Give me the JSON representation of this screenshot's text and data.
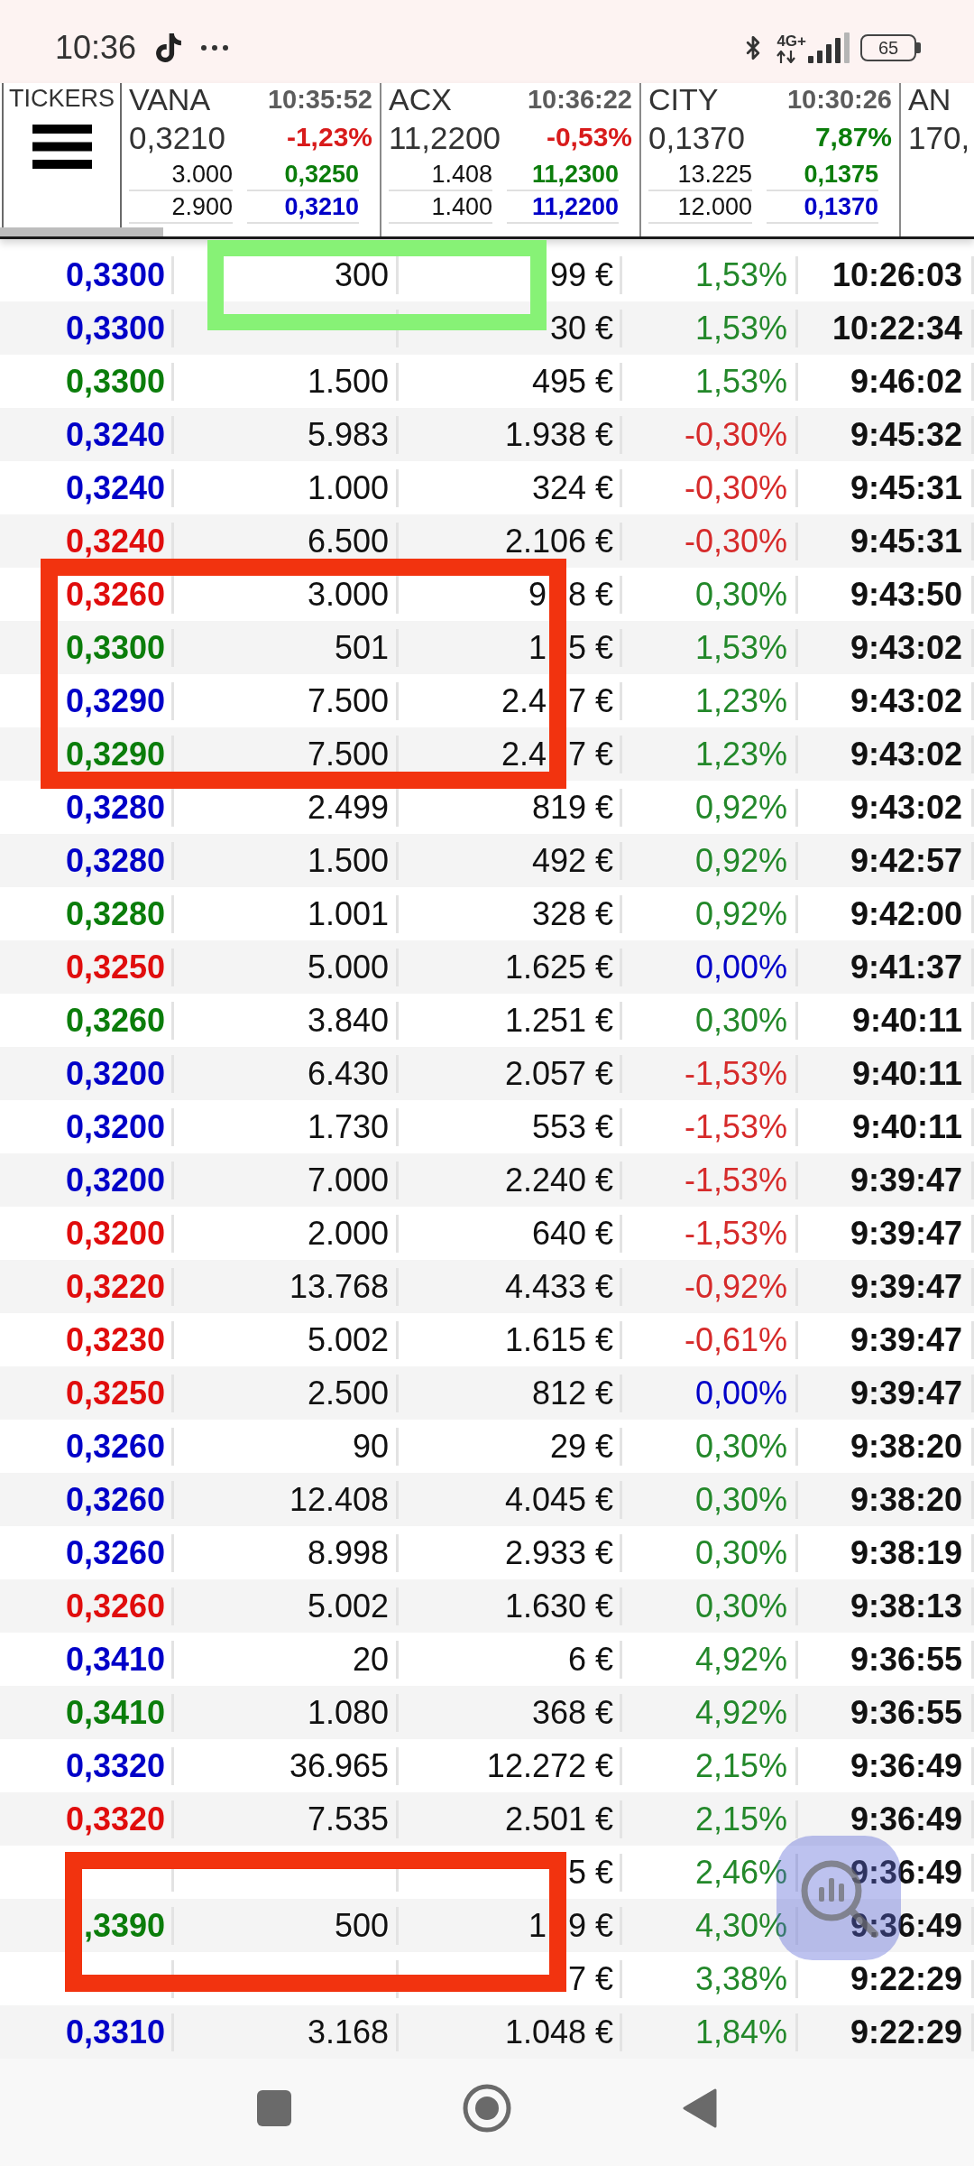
{
  "status_bar": {
    "time": "10:36",
    "network": "4G+",
    "battery": "65"
  },
  "tickers_panel": {
    "label": "TICKERS"
  },
  "tickers": [
    {
      "symbol": "VANA",
      "time": "10:35:52",
      "price": "0,3210",
      "change": {
        "text": "-1,23%",
        "color": "#d81b1b"
      },
      "depth": [
        {
          "quantity": "3.000",
          "price": {
            "text": "0,3250",
            "color": "#0b7d0b"
          }
        },
        {
          "quantity": "2.900",
          "price": {
            "text": "0,3210",
            "color": "#0000c8"
          }
        }
      ]
    },
    {
      "symbol": "ACX",
      "time": "10:36:22",
      "price": "11,2200",
      "change": {
        "text": "-0,53%",
        "color": "#d81b1b"
      },
      "depth": [
        {
          "quantity": "1.408",
          "price": {
            "text": "11,2300",
            "color": "#0b7d0b"
          }
        },
        {
          "quantity": "1.400",
          "price": {
            "text": "11,2200",
            "color": "#0000c8"
          }
        }
      ]
    },
    {
      "symbol": "CITY",
      "time": "10:30:26",
      "price": "0,1370",
      "change": {
        "text": "7,87%",
        "color": "#0b7d0b"
      },
      "depth": [
        {
          "quantity": "13.225",
          "price": {
            "text": "0,1375",
            "color": "#0b7d0b"
          }
        },
        {
          "quantity": "12.000",
          "price": {
            "text": "0,1370",
            "color": "#0000c8"
          }
        }
      ]
    },
    {
      "symbol": "AN",
      "price": "170,"
    }
  ],
  "trades": [
    {
      "price": {
        "text": "0,3300",
        "color": "#0000c8"
      },
      "quantity": "300",
      "amount": "99 €",
      "change": {
        "text": "1,53%",
        "color": "#23882a"
      },
      "time": "10:26:03"
    },
    {
      "price": {
        "text": "0,3300",
        "color": "#0000c8"
      },
      "amount": "30 €",
      "change": {
        "text": "1,53%",
        "color": "#23882a"
      },
      "time": "10:22:34"
    },
    {
      "price": {
        "text": "0,3300",
        "color": "#0b7d0b"
      },
      "quantity": "1.500",
      "amount": "495 €",
      "change": {
        "text": "1,53%",
        "color": "#23882a"
      },
      "time": "9:46:02"
    },
    {
      "price": {
        "text": "0,3240",
        "color": "#0000c8"
      },
      "quantity": "5.983",
      "amount": "1.938 €",
      "change": {
        "text": "-0,30%",
        "color": "#d62b2b"
      },
      "time": "9:45:32"
    },
    {
      "price": {
        "text": "0,3240",
        "color": "#0000c8"
      },
      "quantity": "1.000",
      "amount": "324 €",
      "change": {
        "text": "-0,30%",
        "color": "#d62b2b"
      },
      "time": "9:45:31"
    },
    {
      "price": {
        "text": "0,3240",
        "color": "#e00d0d"
      },
      "quantity": "6.500",
      "amount": "2.106 €",
      "change": {
        "text": "-0,30%",
        "color": "#d62b2b"
      },
      "time": "9:45:31"
    },
    {
      "price": {
        "text": "0,3260",
        "color": "#e00d0d"
      },
      "quantity": "3.000",
      "amount_parts": [
        "9",
        "8 €"
      ],
      "change": {
        "text": "0,30%",
        "color": "#23882a"
      },
      "time": "9:43:50"
    },
    {
      "price": {
        "text": "0,3300",
        "color": "#0b7d0b"
      },
      "quantity": "501",
      "amount_parts": [
        "1",
        "5 €"
      ],
      "change": {
        "text": "1,53%",
        "color": "#23882a"
      },
      "time": "9:43:02"
    },
    {
      "price": {
        "text": "0,3290",
        "color": "#0000c8"
      },
      "quantity": "7.500",
      "amount_parts": [
        "2.4",
        "7 €"
      ],
      "change": {
        "text": "1,23%",
        "color": "#23882a"
      },
      "time": "9:43:02"
    },
    {
      "price": {
        "text": "0,3290",
        "color": "#0b7d0b"
      },
      "quantity": "7.500",
      "amount_parts": [
        "2.4",
        "7 €"
      ],
      "change": {
        "text": "1,23%",
        "color": "#23882a"
      },
      "time": "9:43:02"
    },
    {
      "price": {
        "text": "0,3280",
        "color": "#0000c8"
      },
      "quantity": "2.499",
      "amount": "819 €",
      "change": {
        "text": "0,92%",
        "color": "#23882a"
      },
      "time": "9:43:02"
    },
    {
      "price": {
        "text": "0,3280",
        "color": "#0000c8"
      },
      "quantity": "1.500",
      "amount": "492 €",
      "change": {
        "text": "0,92%",
        "color": "#23882a"
      },
      "time": "9:42:57"
    },
    {
      "price": {
        "text": "0,3280",
        "color": "#0b7d0b"
      },
      "quantity": "1.001",
      "amount": "328 €",
      "change": {
        "text": "0,92%",
        "color": "#23882a"
      },
      "time": "9:42:00"
    },
    {
      "price": {
        "text": "0,3250",
        "color": "#e00d0d"
      },
      "quantity": "5.000",
      "amount": "1.625 €",
      "change": {
        "text": "0,00%",
        "color": "#0000c8"
      },
      "time": "9:41:37"
    },
    {
      "price": {
        "text": "0,3260",
        "color": "#0b7d0b"
      },
      "quantity": "3.840",
      "amount": "1.251 €",
      "change": {
        "text": "0,30%",
        "color": "#23882a"
      },
      "time": "9:40:11"
    },
    {
      "price": {
        "text": "0,3200",
        "color": "#0000c8"
      },
      "quantity": "6.430",
      "amount": "2.057 €",
      "change": {
        "text": "-1,53%",
        "color": "#d62b2b"
      },
      "time": "9:40:11"
    },
    {
      "price": {
        "text": "0,3200",
        "color": "#0000c8"
      },
      "quantity": "1.730",
      "amount": "553 €",
      "change": {
        "text": "-1,53%",
        "color": "#d62b2b"
      },
      "time": "9:40:11"
    },
    {
      "price": {
        "text": "0,3200",
        "color": "#0000c8"
      },
      "quantity": "7.000",
      "amount": "2.240 €",
      "change": {
        "text": "-1,53%",
        "color": "#d62b2b"
      },
      "time": "9:39:47"
    },
    {
      "price": {
        "text": "0,3200",
        "color": "#e00d0d"
      },
      "quantity": "2.000",
      "amount": "640 €",
      "change": {
        "text": "-1,53%",
        "color": "#d62b2b"
      },
      "time": "9:39:47"
    },
    {
      "price": {
        "text": "0,3220",
        "color": "#e00d0d"
      },
      "quantity": "13.768",
      "amount": "4.433 €",
      "change": {
        "text": "-0,92%",
        "color": "#d62b2b"
      },
      "time": "9:39:47"
    },
    {
      "price": {
        "text": "0,3230",
        "color": "#e00d0d"
      },
      "quantity": "5.002",
      "amount": "1.615 €",
      "change": {
        "text": "-0,61%",
        "color": "#d62b2b"
      },
      "time": "9:39:47"
    },
    {
      "price": {
        "text": "0,3250",
        "color": "#e00d0d"
      },
      "quantity": "2.500",
      "amount": "812 €",
      "change": {
        "text": "0,00%",
        "color": "#0000c8"
      },
      "time": "9:39:47"
    },
    {
      "price": {
        "text": "0,3260",
        "color": "#0000c8"
      },
      "quantity": "90",
      "amount": "29 €",
      "change": {
        "text": "0,30%",
        "color": "#23882a"
      },
      "time": "9:38:20"
    },
    {
      "price": {
        "text": "0,3260",
        "color": "#0000c8"
      },
      "quantity": "12.408",
      "amount": "4.045 €",
      "change": {
        "text": "0,30%",
        "color": "#23882a"
      },
      "time": "9:38:20"
    },
    {
      "price": {
        "text": "0,3260",
        "color": "#0000c8"
      },
      "quantity": "8.998",
      "amount": "2.933 €",
      "change": {
        "text": "0,30%",
        "color": "#23882a"
      },
      "time": "9:38:19"
    },
    {
      "price": {
        "text": "0,3260",
        "color": "#e00d0d"
      },
      "quantity": "5.002",
      "amount": "1.630 €",
      "change": {
        "text": "0,30%",
        "color": "#23882a"
      },
      "time": "9:38:13"
    },
    {
      "price": {
        "text": "0,3410",
        "color": "#0000c8"
      },
      "quantity": "20",
      "amount": "6 €",
      "change": {
        "text": "4,92%",
        "color": "#23882a"
      },
      "time": "9:36:55"
    },
    {
      "price": {
        "text": "0,3410",
        "color": "#0b7d0b"
      },
      "quantity": "1.080",
      "amount": "368 €",
      "change": {
        "text": "4,92%",
        "color": "#23882a"
      },
      "time": "9:36:55"
    },
    {
      "price": {
        "text": "0,3320",
        "color": "#0000c8"
      },
      "quantity": "36.965",
      "amount": "12.272 €",
      "change": {
        "text": "2,15%",
        "color": "#23882a"
      },
      "time": "9:36:49"
    },
    {
      "price": {
        "text": "0,3320",
        "color": "#e00d0d"
      },
      "quantity": "7.535",
      "amount": "2.501 €",
      "change": {
        "text": "2,15%",
        "color": "#23882a"
      },
      "time": "9:36:49"
    },
    {
      "amount": "5 €",
      "change": {
        "text": "2,46%",
        "color": "#23882a"
      },
      "time": "9:36:49"
    },
    {
      "price": {
        "text": ",3390",
        "color": "#0b7d0b"
      },
      "quantity": "500",
      "amount_parts": [
        "1",
        "9 €"
      ],
      "change": {
        "text": "4,30%",
        "color": "#23882a"
      },
      "time": "9:36:49"
    },
    {
      "amount": "7 €",
      "change": {
        "text": "3,38%",
        "color": "#23882a"
      },
      "time": "9:22:29"
    },
    {
      "price": {
        "text": "0,3310",
        "color": "#0000c8"
      },
      "quantity": "3.168",
      "amount": "1.048 €",
      "change": {
        "text": "1,84%",
        "color": "#23882a"
      },
      "time": "9:22:29"
    }
  ],
  "annotations": [
    {
      "color": "#87f276"
    },
    {
      "color": "#f2330f"
    },
    {
      "color": "#f2330f"
    }
  ]
}
